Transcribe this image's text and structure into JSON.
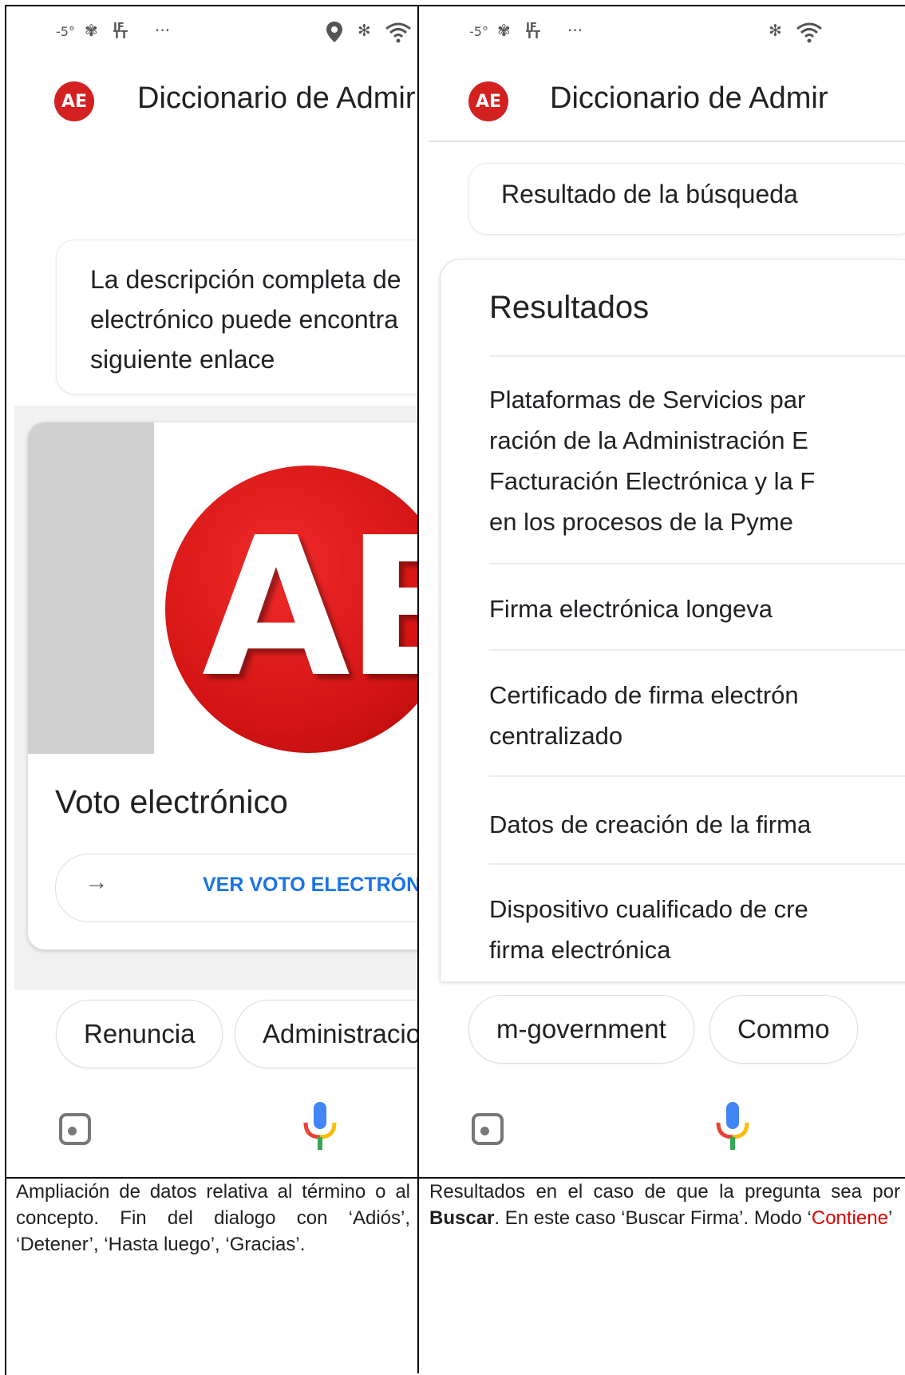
{
  "left": {
    "status": {
      "temp": "-5°",
      "fan": "✾",
      "ifttt": "IFTT",
      "more": "···",
      "location": "⬤",
      "bluetooth": "✻",
      "wifi": "◠"
    },
    "app": {
      "badge": "AE",
      "title": "Diccionario de Admir"
    },
    "message": {
      "lines": [
        "La descripción completa de",
        "electrónico puede encontra",
        "siguiente enlace"
      ]
    },
    "card": {
      "logo_text": "AE",
      "title": "Voto electrónico",
      "action_arrow": "→",
      "action_label": "VER VOTO ELECTRÓNIC"
    },
    "chips": [
      "Renuncia",
      "Administracio"
    ]
  },
  "right": {
    "status": {
      "temp": "-5°",
      "fan": "✾",
      "ifttt": "IFTT",
      "more": "···",
      "bluetooth": "✻",
      "wifi": "◠"
    },
    "app": {
      "badge": "AE",
      "title": "Diccionario de Admir"
    },
    "query_bubble": "Resultado de la búsqueda",
    "results_heading": "Resultados",
    "results": [
      {
        "lines": [
          "Plataformas de Servicios par",
          "ración de la Administración E",
          "Facturación Electrónica y la F",
          "en los procesos de la Pyme"
        ]
      },
      {
        "lines": [
          "Firma electrónica longeva"
        ]
      },
      {
        "lines": [
          "Certificado de firma electrón",
          "centralizado"
        ]
      },
      {
        "lines": [
          "Datos de creación de la firma"
        ]
      },
      {
        "lines": [
          "Dispositivo cualificado de cre",
          "firma electrónica"
        ]
      }
    ],
    "chips": [
      "m-government",
      "Commo"
    ]
  },
  "captions": {
    "left": "Ampliación de datos relativa al término o al concepto. Fin del dialogo con ‘Adiós’, ‘Detener’, ‘Hasta luego’, ‘Gracias’.",
    "right_pre": "Resultados en el caso de que la pregunta sea por ",
    "right_bold": "Buscar",
    "right_mid": ". En este caso ‘Buscar Firma’. Modo ‘",
    "right_red": "Contiene",
    "right_post": "’"
  },
  "colors": {
    "brand_red": "#d32020",
    "action_blue": "#1a73e8",
    "caption_highlight": "#e00000"
  }
}
